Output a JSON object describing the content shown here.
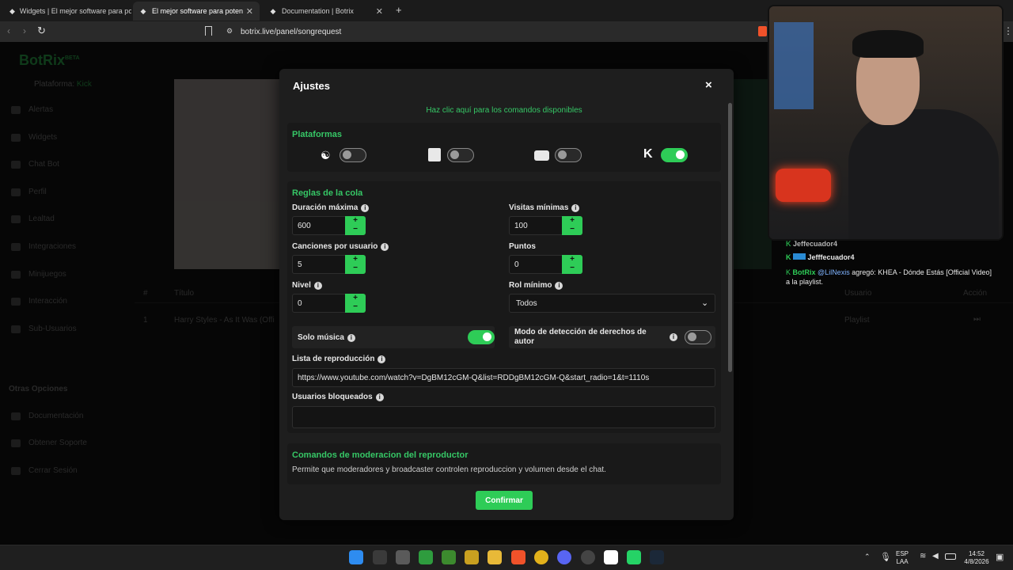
{
  "browser": {
    "tabs": [
      {
        "label": "Widgets | El mejor software para pot",
        "active": false
      },
      {
        "label": "El mejor software para poten",
        "active": true
      },
      {
        "label": "Documentation | Botrix",
        "active": false
      }
    ],
    "new_tab": "+",
    "url": "botrix.live/panel/songrequest"
  },
  "sidebar": {
    "brand": "BotRix",
    "brand_badge": "BETA",
    "platform_label": "Plataforma:",
    "platform_value": "Kick",
    "items": [
      "Alertas",
      "Widgets",
      "Chat Bot",
      "Perfil",
      "Lealtad",
      "Integraciones",
      "Minijuegos",
      "Interacción",
      "Sub-Usuarios"
    ],
    "section_other": "Otras Opciones",
    "other_items": [
      "Documentación",
      "Obtener Soporte",
      "Cerrar Sesión"
    ]
  },
  "background_table": {
    "headers": [
      "#",
      "Título",
      "Usuario",
      "Acción"
    ],
    "row": {
      "num": "1",
      "title": "Harry Styles - As It Was (Offi",
      "user": "Playlist"
    },
    "button": "Ajustes",
    "cover_text": "lt Wa",
    "cover_sub": "arryStyl"
  },
  "modal": {
    "title": "Ajustes",
    "close": "×",
    "commands_link": "Haz clic aquí para los comandos disponibles",
    "platforms_title": "Plataformas",
    "queue_title": "Reglas de la cola",
    "fields": {
      "max_duration_label": "Duración máxima",
      "max_duration_value": "600",
      "min_views_label": "Visitas mínimas",
      "min_views_value": "100",
      "songs_per_user_label": "Canciones por usuario",
      "songs_per_user_value": "5",
      "points_label": "Puntos",
      "points_value": "0",
      "level_label": "Nivel",
      "level_value": "0",
      "min_role_label": "Rol mínimo",
      "min_role_value": "Todos"
    },
    "music_only_label": "Solo música",
    "copyright_label": "Modo de detección de derechos de autor",
    "playlist_label": "Lista de reproducción",
    "playlist_value": "https://www.youtube.com/watch?v=DgBM12cGM-Q&list=RDDgBM12cGM-Q&start_radio=1&t=1110s",
    "blocked_label": "Usuarios bloqueados",
    "blocked_value": "",
    "mod_title": "Comandos de moderacion del reproductor",
    "mod_desc": "Permite que moderadores y broadcaster controlen reproduccion y volumen desde el chat.",
    "confirm": "Confirmar"
  },
  "chat": {
    "line1_user": "Jeffecuador4",
    "line2_user": "Jefffecuador4",
    "line3_user": "BotRix",
    "line3_mention": "@LilNexis",
    "line3_text": " agregó: KHEA - Dónde Estás [Official Video]",
    "line3_cont": "a la playlist."
  },
  "taskbar": {
    "lang1": "ESP",
    "lang2": "LAA",
    "time": "14:52",
    "date": "4/8/2026"
  },
  "colors": {
    "accent": "#2ecc57",
    "modal_bg": "#1e1e1e"
  }
}
